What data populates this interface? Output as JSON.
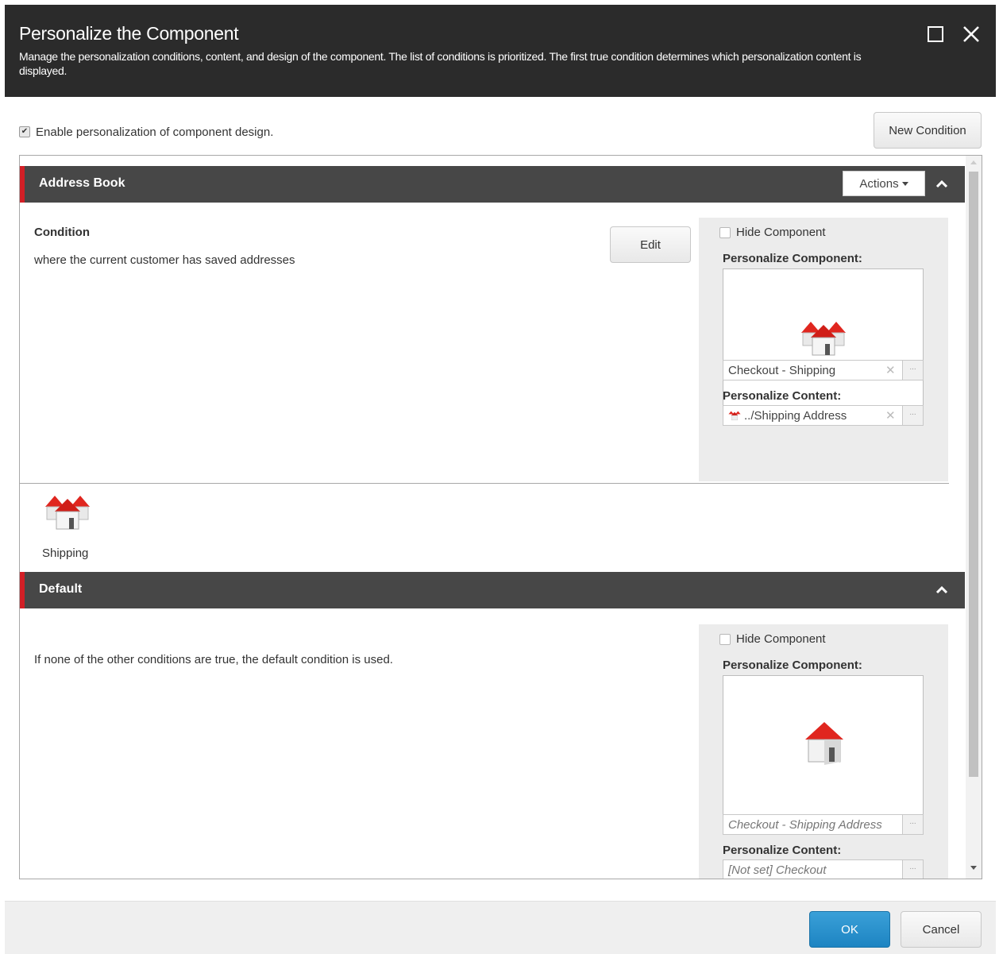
{
  "dialog": {
    "title": "Personalize the Component",
    "description": "Manage the personalization conditions, content, and design of the component. The list of conditions is prioritized. The first true condition determines which personalization content is displayed."
  },
  "enable": {
    "label": "Enable personalization of component design.",
    "checked": true
  },
  "new_condition_label": "New Condition",
  "sections": [
    {
      "name": "Address Book",
      "actions_label": "Actions",
      "condition_label": "Condition",
      "condition_text": "where the current customer has saved addresses",
      "edit_label": "Edit",
      "hide_component_label": "Hide Component",
      "personalize_component_label": "Personalize Component:",
      "component_value": "Checkout - Shipping",
      "personalize_content_label": "Personalize Content:",
      "content_value": "../Shipping Address",
      "variant_label": "Shipping",
      "icon": "houses-icon"
    },
    {
      "name": "Default",
      "condition_text": "If none of the other conditions are true, the default condition is used.",
      "hide_component_label": "Hide Component",
      "personalize_component_label": "Personalize Component:",
      "component_value": "Checkout - Shipping Address",
      "personalize_content_label": "Personalize Content:",
      "content_value": "[Not set] Checkout",
      "icon": "house-icon"
    }
  ],
  "browse_glyph": "...",
  "clear_glyph": "✕",
  "footer": {
    "ok_label": "OK",
    "cancel_label": "Cancel"
  },
  "colors": {
    "title_bg": "#2b2b2b",
    "section_header_bg": "#474747",
    "accent_red": "#d21f26",
    "ok_blue": "#1d84c2"
  }
}
